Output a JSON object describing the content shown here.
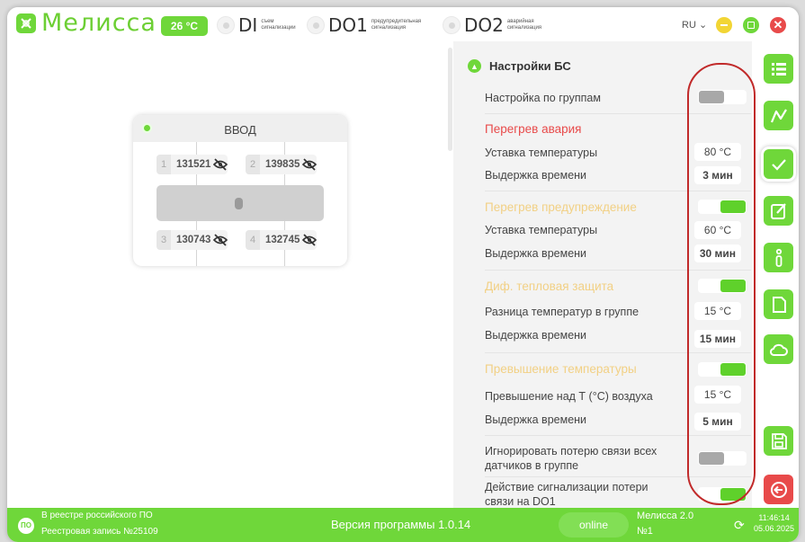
{
  "header": {
    "app_name": "Мелисса",
    "temperature": "26 °C",
    "indicators": [
      {
        "code": "DI",
        "desc": "съем сигнализации"
      },
      {
        "code": "DO1",
        "desc": "предупредительная сигнализация"
      },
      {
        "code": "DO2",
        "desc": "аварийная сигнализация"
      }
    ],
    "language": "RU ⌄",
    "close_glyph": "✕"
  },
  "card": {
    "title": "ВВОД",
    "sensors": [
      {
        "num": "1",
        "value": "131521"
      },
      {
        "num": "2",
        "value": "139835"
      },
      {
        "num": "3",
        "value": "130743"
      },
      {
        "num": "4",
        "value": "132745"
      }
    ]
  },
  "settings": {
    "section_title": "Настройки БС",
    "group_setting": "Настройка по группам",
    "overheat_alarm": "Перегрев авария",
    "setpoint_temp_1": "Уставка температуры",
    "setpoint_temp_1_value": "80 °C",
    "delay_1": "Выдержка времени",
    "delay_1_value": "3 мин",
    "overheat_warning": "Перегрев предупреждение",
    "setpoint_temp_2": "Уставка температуры",
    "setpoint_temp_2_value": "60 °C",
    "delay_2": "Выдержка времени",
    "delay_2_value": "30 мин",
    "diff_protection": "Диф. тепловая защита",
    "temp_diff_group": "Разница температур в группе",
    "temp_diff_value": "15 °C",
    "delay_3": "Выдержка времени",
    "delay_3_value": "15 мин",
    "temp_exceed": "Превышение температуры",
    "exceed_over_air": "Превышение над Т (°C) воздуха",
    "exceed_over_air_value": "15 °C",
    "delay_4": "Выдержка времени",
    "delay_4_value": "5 мин",
    "ignore_loss_l1": "Игнорировать потерю связи всех",
    "ignore_loss_l2": "датчиков в группе",
    "loss_action_l1": "Действие сигнализации потери",
    "loss_action_l2": "связи на DO1",
    "toggles": {
      "group_setting": false,
      "overheat_warning": true,
      "diff_protection": true,
      "temp_exceed": true,
      "ignore_loss": false,
      "loss_action": true
    }
  },
  "footer": {
    "registry_line1": "В реестре российского ПО",
    "registry_line2": "Реестровая запись №25109",
    "version": "Версия программы  1.0.14",
    "status": "online",
    "device_line1": "Мелисса 2.0",
    "device_line2": "№1",
    "time": "11:46:14",
    "date": "05.06.2025"
  },
  "colors": {
    "brand_green": "#6fd73a",
    "alarm_red": "#e84a4a",
    "warning_yellow": "#f2d084",
    "highlight_oval": "#c12a2a"
  }
}
